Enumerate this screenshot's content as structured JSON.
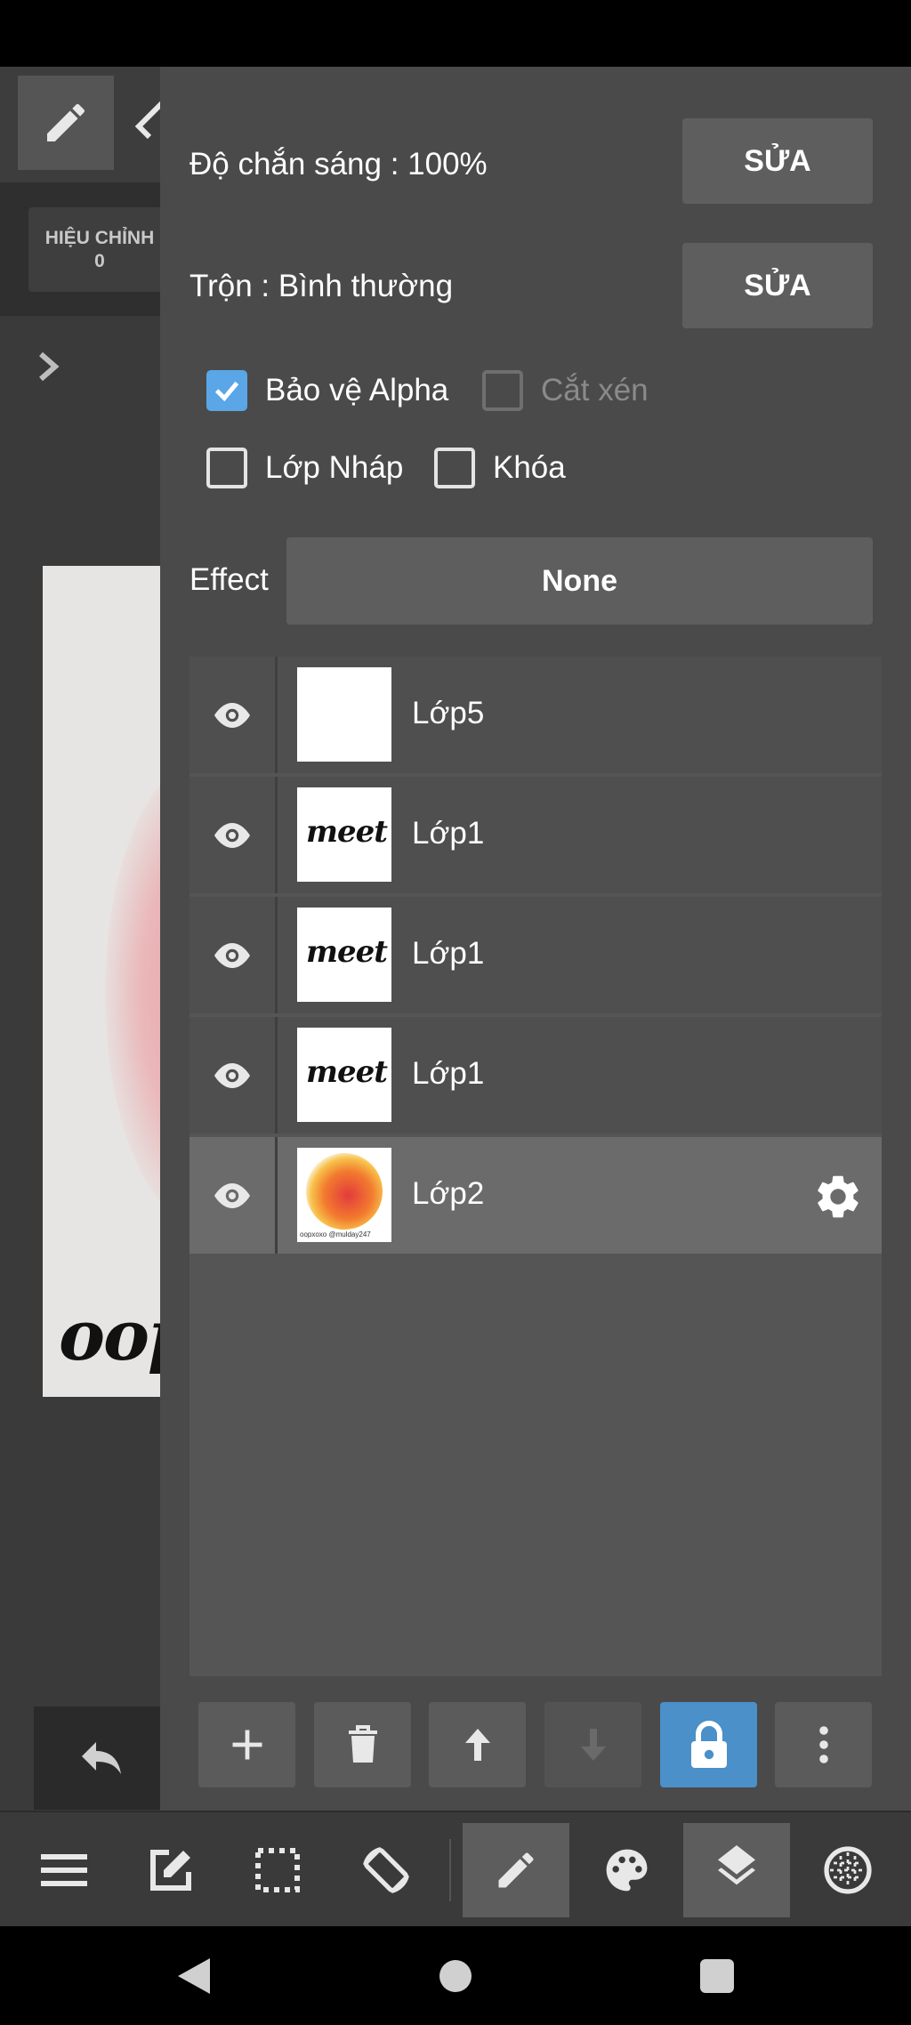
{
  "left_panel": {
    "adjust_label": "HIỆU CHỈNH",
    "adjust_value": "0",
    "canvas_text": "oop"
  },
  "properties": {
    "opacity_label": "Độ chắn sáng : 100%",
    "blend_label": "Trộn : Bình thường",
    "edit_label": "SỬA"
  },
  "checkboxes": {
    "alpha_protect": {
      "label": "Bảo vệ Alpha",
      "checked": true
    },
    "clipping": {
      "label": "Cắt xén",
      "checked": false,
      "enabled": false
    },
    "draft_layer": {
      "label": "Lớp Nháp",
      "checked": false
    },
    "lock": {
      "label": "Khóa",
      "checked": false
    }
  },
  "effect": {
    "label": "Effect",
    "value": "None"
  },
  "layers": [
    {
      "name": "Lớp5",
      "thumb": "blank",
      "visible": true,
      "selected": false
    },
    {
      "name": "Lớp1",
      "thumb": "meet",
      "visible": true,
      "selected": false
    },
    {
      "name": "Lớp1",
      "thumb": "meet",
      "visible": true,
      "selected": false
    },
    {
      "name": "Lớp1",
      "thumb": "meet",
      "visible": true,
      "selected": false
    },
    {
      "name": "Lớp2",
      "thumb": "blob",
      "visible": true,
      "selected": true
    }
  ],
  "thumb_text": {
    "meet": "meet",
    "blob_caption": "oopxoxo @mulday247"
  },
  "layer_actions": [
    "add-icon",
    "trash-icon",
    "arrow-up-icon",
    "arrow-down-icon",
    "lock-icon",
    "more-vert-icon"
  ],
  "bottom_toolbar": [
    "menu-icon",
    "edit-square-icon",
    "selection-icon",
    "rotate-screen-icon",
    "brush-icon",
    "palette-icon",
    "layers-icon",
    "grid-icon"
  ],
  "colors": {
    "accent": "#5aa6e6",
    "lock_active": "#4b90c8",
    "panel": "#4a4a4a"
  }
}
